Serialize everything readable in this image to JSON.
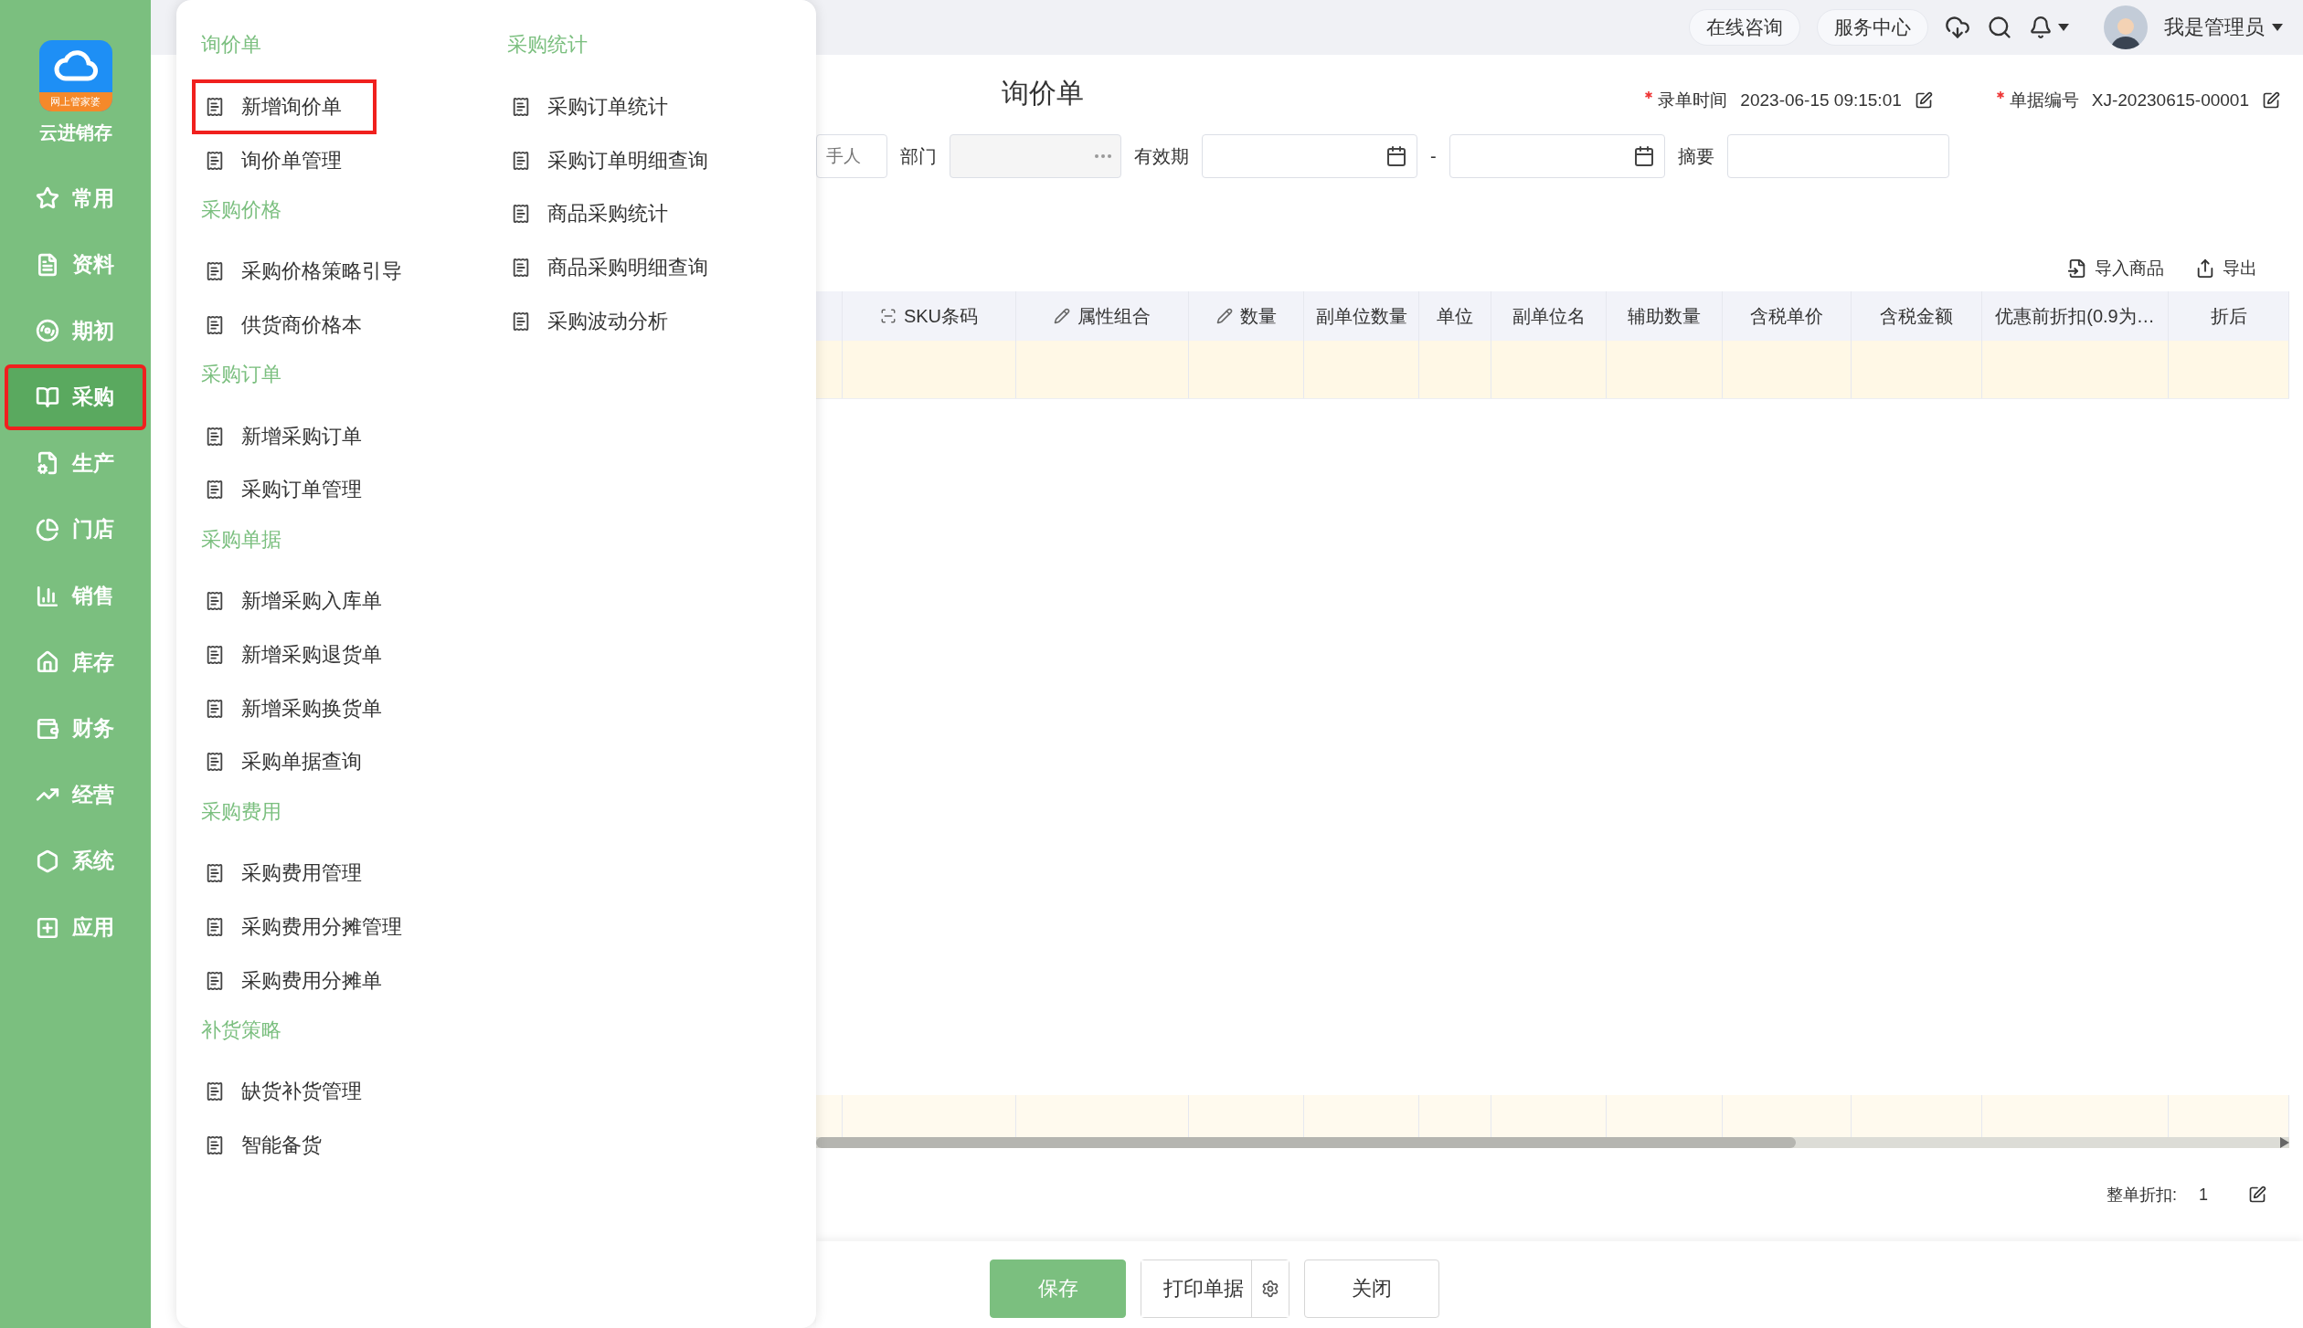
{
  "sidebar": {
    "logo_badge": "网上管家婆",
    "app_name": "云进销存",
    "items": [
      {
        "label": "常用",
        "selected": false,
        "highlighted": false
      },
      {
        "label": "资料",
        "selected": false,
        "highlighted": false
      },
      {
        "label": "期初",
        "selected": false,
        "highlighted": false
      },
      {
        "label": "采购",
        "selected": true,
        "highlighted": true
      },
      {
        "label": "生产",
        "selected": false,
        "highlighted": false
      },
      {
        "label": "门店",
        "selected": false,
        "highlighted": false
      },
      {
        "label": "销售",
        "selected": false,
        "highlighted": false
      },
      {
        "label": "库存",
        "selected": false,
        "highlighted": false
      },
      {
        "label": "财务",
        "selected": false,
        "highlighted": false
      },
      {
        "label": "经营",
        "selected": false,
        "highlighted": false
      },
      {
        "label": "系统",
        "selected": false,
        "highlighted": false
      },
      {
        "label": "应用",
        "selected": false,
        "highlighted": false
      }
    ]
  },
  "menu": {
    "columns": [
      {
        "sections": [
          {
            "title": "询价单",
            "items": [
              {
                "label": "新增询价单",
                "highlighted": true
              },
              {
                "label": "询价单管理",
                "highlighted": false
              }
            ]
          },
          {
            "title": "采购价格",
            "items": [
              {
                "label": "采购价格策略引导",
                "highlighted": false
              },
              {
                "label": "供货商价格本",
                "highlighted": false
              }
            ]
          },
          {
            "title": "采购订单",
            "items": [
              {
                "label": "新增采购订单",
                "highlighted": false
              },
              {
                "label": "采购订单管理",
                "highlighted": false
              }
            ]
          },
          {
            "title": "采购单据",
            "items": [
              {
                "label": "新增采购入库单",
                "highlighted": false
              },
              {
                "label": "新增采购退货单",
                "highlighted": false
              },
              {
                "label": "新增采购换货单",
                "highlighted": false
              },
              {
                "label": "采购单据查询",
                "highlighted": false
              }
            ]
          },
          {
            "title": "采购费用",
            "items": [
              {
                "label": "采购费用管理",
                "highlighted": false
              },
              {
                "label": "采购费用分摊管理",
                "highlighted": false
              },
              {
                "label": "采购费用分摊单",
                "highlighted": false
              }
            ]
          },
          {
            "title": "补货策略",
            "items": [
              {
                "label": "缺货补货管理",
                "highlighted": false
              },
              {
                "label": "智能备货",
                "highlighted": false
              }
            ]
          }
        ]
      },
      {
        "sections": [
          {
            "title": "采购统计",
            "items": [
              {
                "label": "采购订单统计",
                "highlighted": false
              },
              {
                "label": "采购订单明细查询",
                "highlighted": false
              },
              {
                "label": "商品采购统计",
                "highlighted": false
              },
              {
                "label": "商品采购明细查询",
                "highlighted": false
              },
              {
                "label": "采购波动分析",
                "highlighted": false
              }
            ]
          }
        ]
      }
    ]
  },
  "header": {
    "links": [
      "在线咨询",
      "服务中心"
    ],
    "user": "我是管理员"
  },
  "form": {
    "title": "询价单",
    "meta": [
      {
        "label": "录单时间",
        "value": "2023-06-15 09:15:01",
        "required": true
      },
      {
        "label": "单据编号",
        "value": "XJ-20230615-00001",
        "required": true
      }
    ],
    "fields": [
      {
        "kind": "text",
        "placeholder": "手人"
      },
      {
        "kind": "picker",
        "label": "部门"
      },
      {
        "kind": "daterange",
        "label": "有效期",
        "separator": "-"
      },
      {
        "kind": "text",
        "label": "摘要"
      }
    ]
  },
  "toolbar": [
    {
      "label": "导入商品",
      "kind": "import"
    },
    {
      "label": "导出",
      "kind": "export"
    }
  ],
  "table": {
    "columns": [
      {
        "label": "SKU条码",
        "kind": "scan"
      },
      {
        "label": "属性组合",
        "kind": "edit"
      },
      {
        "label": "数量",
        "kind": "edit"
      },
      {
        "label": "副单位数量",
        "kind": "plain"
      },
      {
        "label": "单位",
        "kind": "plain"
      },
      {
        "label": "副单位名",
        "kind": "plain"
      },
      {
        "label": "辅助数量",
        "kind": "plain"
      },
      {
        "label": "含税单价",
        "kind": "plain"
      },
      {
        "label": "含税金额",
        "kind": "plain"
      },
      {
        "label": "优惠前折扣(0.9为…",
        "kind": "plain"
      },
      {
        "label": "折后",
        "kind": "plain"
      }
    ]
  },
  "discount": {
    "label": "整单折扣:",
    "value": "1"
  },
  "buttons": [
    {
      "label": "保存",
      "kind": "primary"
    },
    {
      "label": "打印单据",
      "kind": "split"
    },
    {
      "label": "关闭",
      "kind": "default"
    }
  ]
}
